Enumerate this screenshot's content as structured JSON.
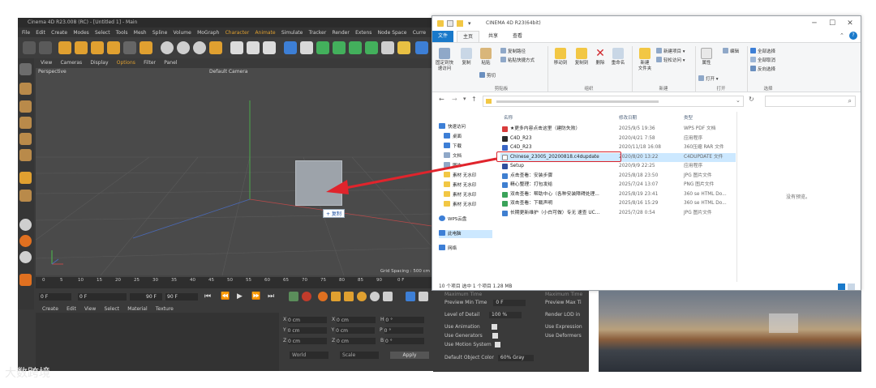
{
  "c4d": {
    "title": "Cinema 4D R23.008 (RC) - [Untitled 1] - Main",
    "menu": [
      "File",
      "Edit",
      "Create",
      "Modes",
      "Select",
      "Tools",
      "Mesh",
      "Spline",
      "Volume",
      "MoGraph",
      "Character",
      "Animate",
      "Simulate",
      "Tracker",
      "Render",
      "Extens",
      "Node Space",
      "Curre"
    ],
    "viewport_menu": [
      "View",
      "Cameras",
      "Display",
      "Options",
      "Filter",
      "Panel"
    ],
    "viewport_label": "Perspective",
    "camera_label": "Default Camera",
    "drop_badge": "+ 复制",
    "grid_spacing": "Grid Spacing : 500 cm",
    "timeline_ticks": [
      "0",
      "5",
      "10",
      "15",
      "20",
      "25",
      "30",
      "35",
      "40",
      "45",
      "50",
      "55",
      "60",
      "65",
      "70",
      "75",
      "80",
      "85",
      "90"
    ],
    "timeline_end": "0 F",
    "transport_fields": [
      "0 F",
      "0 F",
      "90 F",
      "90 F"
    ],
    "material_menu": [
      "Create",
      "Edit",
      "View",
      "Select",
      "Material",
      "Texture"
    ],
    "coords": {
      "rows": [
        {
          "a": "X",
          "v1": "0 cm",
          "b": "X",
          "v2": "0 cm",
          "c": "H",
          "v3": "0 °"
        },
        {
          "a": "Y",
          "v1": "0 cm",
          "b": "Y",
          "v2": "0 cm",
          "c": "P",
          "v3": "0 °"
        },
        {
          "a": "Z",
          "v1": "0 cm",
          "b": "Z",
          "v2": "0 cm",
          "c": "B",
          "v3": "0 °"
        }
      ],
      "world": "World",
      "scale": "Scale",
      "apply": "Apply"
    },
    "attributes": {
      "maximum_time": "Maximum Time",
      "preview_min_time": "Preview Min Time",
      "preview_min_value": "0 F",
      "preview_max": "Preview Max Ti",
      "level_of_detail": "Level of Detail",
      "lod_value": "100 %",
      "render_lod": "Render LOD in",
      "use_animation": "Use Animation",
      "use_expression": "Use Expression",
      "use_generators": "Use Generators",
      "use_deformers": "Use Deformers",
      "use_motion_system": "Use Motion System",
      "default_color_label": "Default Object Color",
      "default_color_value": "60% Gray"
    }
  },
  "explorer": {
    "title": "CINEMA 4D R23(64bit)",
    "tabs": [
      "文件",
      "主页",
      "共享",
      "查看"
    ],
    "ribbon": {
      "pin": "固定到快\n速访问",
      "copy": "复制",
      "paste": "粘贴",
      "copy_path": "复制路径",
      "paste_shortcut": "粘贴快捷方式",
      "cut": "剪切",
      "clipboard": "剪贴板",
      "move_to": "移动到",
      "copy_to": "复制到",
      "delete": "删除",
      "rename": "重命名",
      "organize": "组织",
      "new_folder": "新建\n文件夹",
      "new_item": "新建项目 ▾",
      "easy_access": "轻松访问 ▾",
      "new": "新建",
      "properties": "属性",
      "open": "打开 ▾",
      "edit": "编辑",
      "open_group": "打开",
      "select_all": "全部选择",
      "select_none": "全部取消",
      "invert": "反向选择",
      "select": "选择"
    },
    "search_placeholder": "",
    "nav": [
      "快速访问",
      "桌面",
      "下载",
      "文档",
      "图片",
      "素材 无水印",
      "素材 无水印",
      "素材 无水印",
      "素材 无水印",
      "WPS云盘",
      "此电脑",
      "网络"
    ],
    "columns": [
      "名称",
      "修改日期",
      "类型"
    ],
    "files": [
      {
        "name": "★更多内容点击这里（建防失败）",
        "date": "2025/9/5 19:36",
        "type": "WPS PDF 文档",
        "color": "#d83b3b"
      },
      {
        "name": "C4D_R23",
        "date": "2020/4/21 7:58",
        "type": "应用程序",
        "color": "#2b2b2b"
      },
      {
        "name": "C4D_R23",
        "date": "2020/11/18 16:08",
        "type": "360压缩 RAR 文件",
        "color": "#3a66c4"
      },
      {
        "name": "Chinese_23005_20200818.c4dupdate",
        "date": "2020/8/20 13:22",
        "type": "C4DUPDATE 文件",
        "color": "#ffffff"
      },
      {
        "name": "Setup",
        "date": "2020/9/9 22:25",
        "type": "应用程序",
        "color": "#2f4f9e"
      },
      {
        "name": "点击查看：安装步骤",
        "date": "2025/8/18 23:50",
        "type": "JPG 图片文件",
        "color": "#3f7fd0"
      },
      {
        "name": "精心整理：打包发给",
        "date": "2025/7/24 13:07",
        "type": "PNG 图片文件",
        "color": "#3f7fd0"
      },
      {
        "name": "双击查看：帮助中心（各种安装障碍处理...",
        "date": "2025/8/19 23:41",
        "type": "360 se HTML Do...",
        "color": "#3aa35a"
      },
      {
        "name": "双击查看：下载声明",
        "date": "2025/8/16 15:29",
        "type": "360 se HTML Do...",
        "color": "#3aa35a"
      },
      {
        "name": "长期更新维护（小白可做）专无 速查 UC...",
        "date": "2025/7/28 0:54",
        "type": "JPG 图片文件",
        "color": "#3f7fd0"
      }
    ],
    "no_preview": "没有预览。",
    "status": "10 个项目   选中 1 个项目  1.28 MB"
  },
  "watermark": "大数跨境"
}
